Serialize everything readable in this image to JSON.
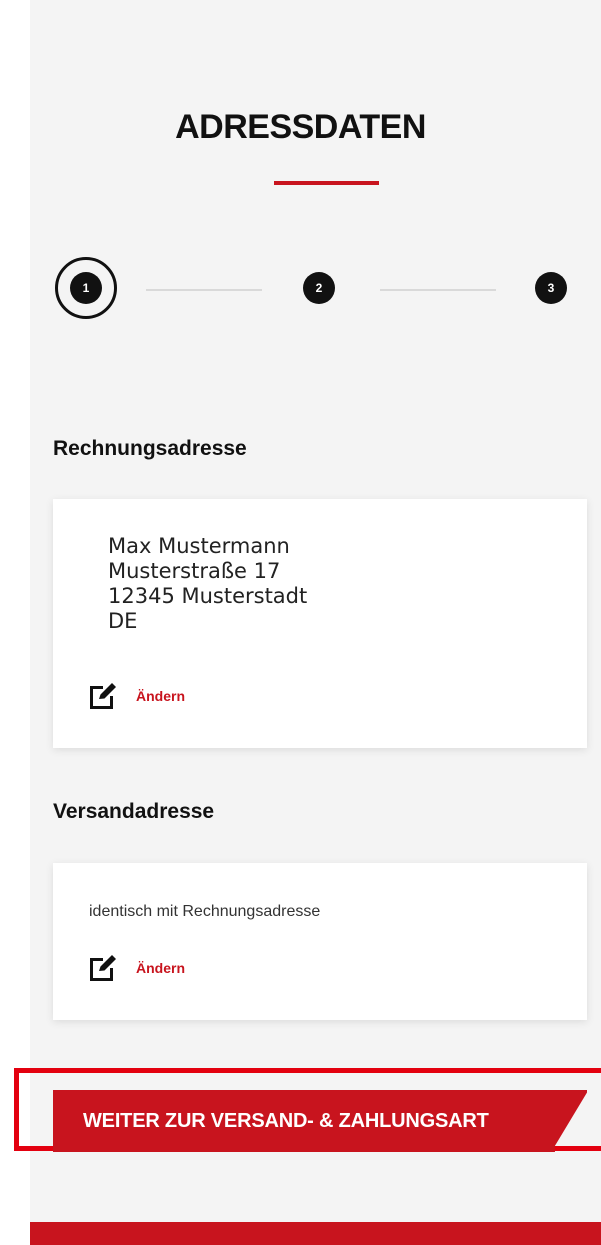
{
  "page": {
    "title": "ADRESSDATEN"
  },
  "stepper": {
    "steps": [
      "1",
      "2",
      "3"
    ],
    "current": 1
  },
  "billing": {
    "heading": "Rechnungsadresse",
    "address_lines": [
      "Max Mustermann",
      "Musterstraße 17",
      "12345 Musterstadt",
      "DE"
    ],
    "change_label": "Ändern",
    "change_icon": "edit-icon"
  },
  "shipping": {
    "heading": "Versandadresse",
    "text": "identisch mit Rechnungsadresse",
    "change_label": "Ändern",
    "change_icon": "edit-icon"
  },
  "cta": {
    "label": "WEITER ZUR VERSAND- & ZAHLUNGSART"
  },
  "colors": {
    "accent": "#c8141e",
    "highlight_border": "#e3000f",
    "background": "#f4f4f4"
  }
}
